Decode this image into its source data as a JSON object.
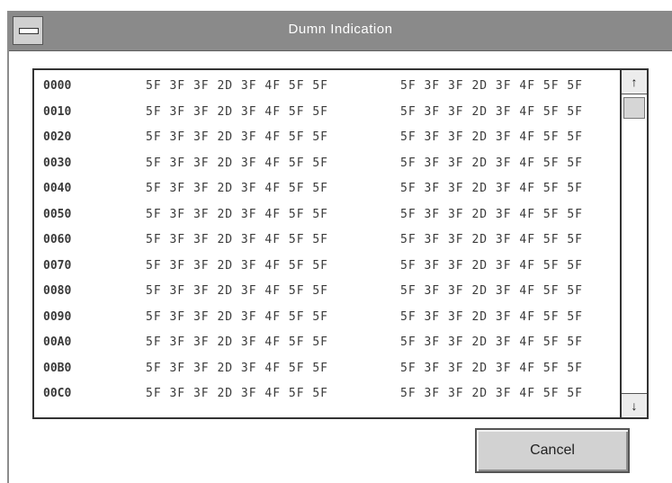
{
  "window": {
    "title": "Dumn Indication"
  },
  "dump": {
    "rows": [
      {
        "addr": "0000",
        "g1": "5F 3F 3F 2D 3F 4F 5F 5F",
        "g2": "5F 3F 3F 2D 3F 4F 5F 5F"
      },
      {
        "addr": "0010",
        "g1": "5F 3F 3F 2D 3F 4F 5F 5F",
        "g2": "5F 3F 3F 2D 3F 4F 5F 5F"
      },
      {
        "addr": "0020",
        "g1": "5F 3F 3F 2D 3F 4F 5F 5F",
        "g2": "5F 3F 3F 2D 3F 4F 5F 5F"
      },
      {
        "addr": "0030",
        "g1": "5F 3F 3F 2D 3F 4F 5F 5F",
        "g2": "5F 3F 3F 2D 3F 4F 5F 5F"
      },
      {
        "addr": "0040",
        "g1": "5F 3F 3F 2D 3F 4F 5F 5F",
        "g2": "5F 3F 3F 2D 3F 4F 5F 5F"
      },
      {
        "addr": "0050",
        "g1": "5F 3F 3F 2D 3F 4F 5F 5F",
        "g2": "5F 3F 3F 2D 3F 4F 5F 5F"
      },
      {
        "addr": "0060",
        "g1": "5F 3F 3F 2D 3F 4F 5F 5F",
        "g2": "5F 3F 3F 2D 3F 4F 5F 5F"
      },
      {
        "addr": "0070",
        "g1": "5F 3F 3F 2D 3F 4F 5F 5F",
        "g2": "5F 3F 3F 2D 3F 4F 5F 5F"
      },
      {
        "addr": "0080",
        "g1": "5F 3F 3F 2D 3F 4F 5F 5F",
        "g2": "5F 3F 3F 2D 3F 4F 5F 5F"
      },
      {
        "addr": "0090",
        "g1": "5F 3F 3F 2D 3F 4F 5F 5F",
        "g2": "5F 3F 3F 2D 3F 4F 5F 5F"
      },
      {
        "addr": "00A0",
        "g1": "5F 3F 3F 2D 3F 4F 5F 5F",
        "g2": "5F 3F 3F 2D 3F 4F 5F 5F"
      },
      {
        "addr": "00B0",
        "g1": "5F 3F 3F 2D 3F 4F 5F 5F",
        "g2": "5F 3F 3F 2D 3F 4F 5F 5F"
      },
      {
        "addr": "00C0",
        "g1": "5F 3F 3F 2D 3F 4F 5F 5F",
        "g2": "5F 3F 3F 2D 3F 4F 5F 5F"
      }
    ]
  },
  "scrollbar": {
    "up_icon": "↑",
    "down_icon": "↓"
  },
  "buttons": {
    "cancel_label": "Cancel"
  },
  "colors": {
    "titlebar": "#8a8a8a",
    "button_face": "#d2d2d2"
  }
}
